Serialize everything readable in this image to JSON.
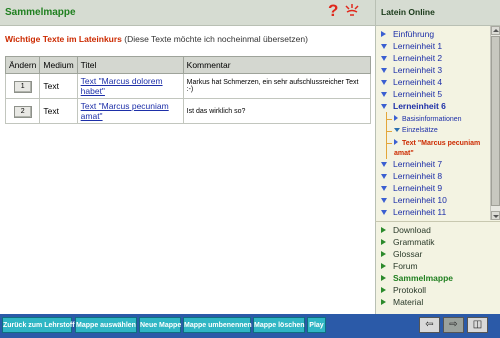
{
  "header": {
    "title": "Sammelmappe",
    "help_symbol": "?"
  },
  "sidebar_header": {
    "title": "Latein Online"
  },
  "main": {
    "heading": "Wichtige Texte im Lateinkurs",
    "subheading": "(Diese Texte möchte ich nocheinmal übersetzen)",
    "table": {
      "columns": [
        "Ändern",
        "Medium",
        "Titel",
        "Kommentar"
      ],
      "rows": [
        {
          "button": "1",
          "medium": "Text",
          "title": "Text \"Marcus dolorem habet\"",
          "comment": "Markus hat Schmerzen, ein sehr aufschlussreicher Text :-)"
        },
        {
          "button": "2",
          "medium": "Text",
          "title": "Text \"Marcus pecuniam amat\"",
          "comment": "Ist das wirklich so?"
        }
      ]
    }
  },
  "nav_upper": {
    "items": [
      "Einführung",
      "Lerneinheit 1",
      "Lerneinheit 2",
      "Lerneinheit 3",
      "Lerneinheit 4",
      "Lerneinheit 5"
    ],
    "open_item": "Lerneinheit 6",
    "sub_items": [
      "Basisinformationen",
      "Einzelsätze"
    ],
    "current_item": "Text \"Marcus pecuniam amat\"",
    "items_after": [
      "Lerneinheit 7",
      "Lerneinheit 8",
      "Lerneinheit 9",
      "Lerneinheit 10",
      "Lerneinheit 11"
    ]
  },
  "nav_lower": {
    "items": [
      "Download",
      "Grammatik",
      "Glossar",
      "Forum",
      "Sammelmappe",
      "Protokoll",
      "Material"
    ]
  },
  "footer": {
    "buttons": [
      "Zurück zum Lehrstoff",
      "Mappe auswählen",
      "Neue Mappe",
      "Mappe umbenennen",
      "Mappe löschen",
      "Play"
    ],
    "nav_back": "⇦",
    "nav_forward": "⇨",
    "nav_window": "◫"
  },
  "colors": {
    "title_green": "#1f7f1f",
    "heading_red": "#cc2a00",
    "link_blue": "#1d2fa8",
    "footer_bar": "#2b5aa8",
    "footer_button": "#2fb6c4",
    "sidebar_bg": "#f3f3e2"
  }
}
